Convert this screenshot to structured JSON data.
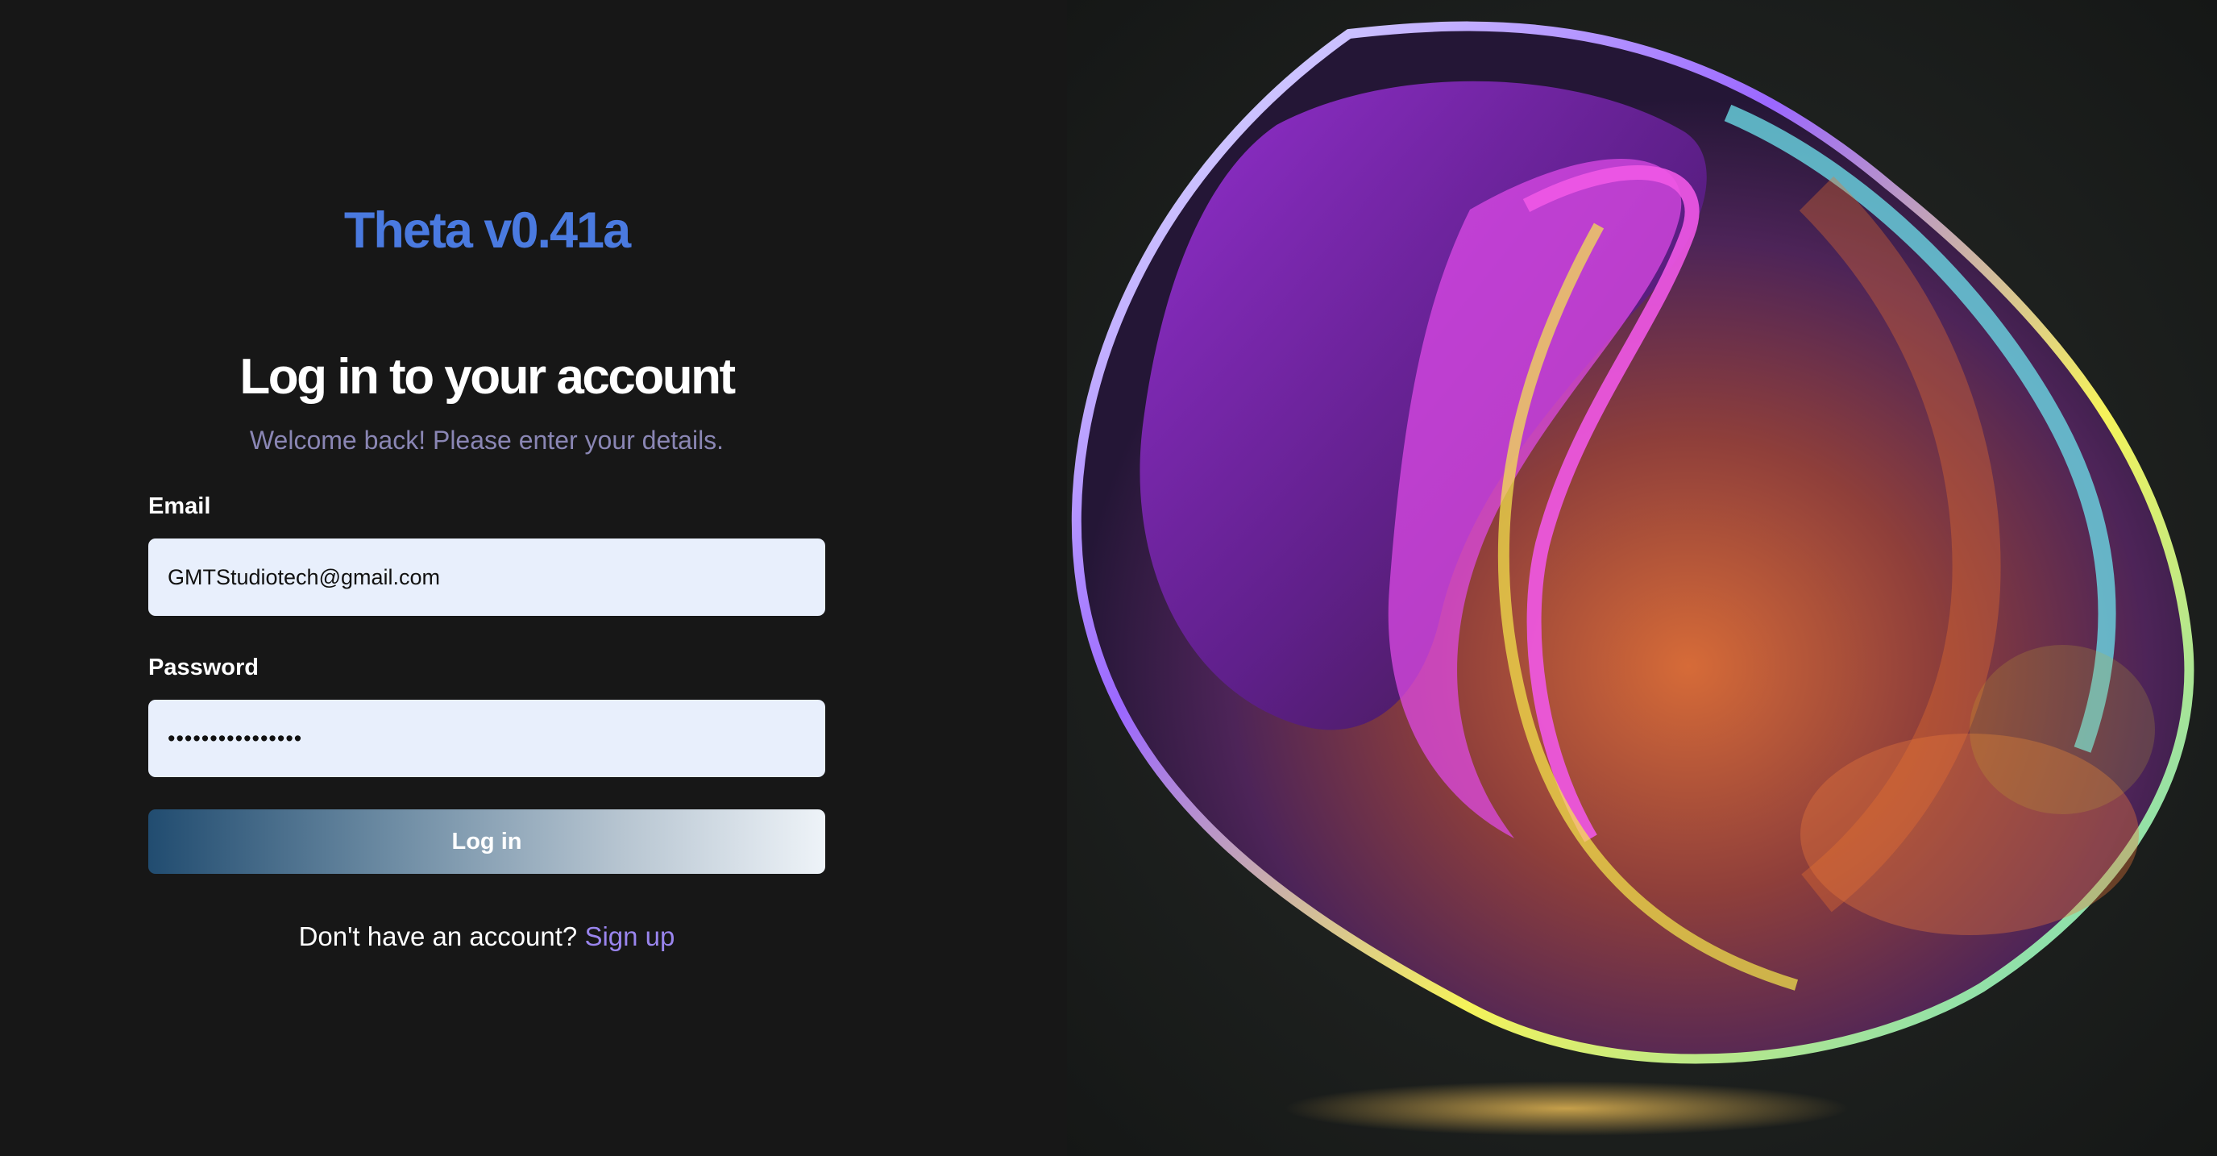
{
  "brand": {
    "name": "Theta v0.41a"
  },
  "login": {
    "title": "Log in to your account",
    "subtitle": "Welcome back! Please enter your details.",
    "email_label": "Email",
    "email_value": "GMTStudiotech@gmail.com",
    "password_label": "Password",
    "password_value": "••••••••••••••••",
    "submit_label": "Log in",
    "signup_prompt": "Don't have an account?",
    "signup_link": "Sign up"
  },
  "colors": {
    "background": "#171717",
    "brand": "#4a7ae0",
    "input_background": "#e8effc",
    "link": "#9a85ee"
  }
}
